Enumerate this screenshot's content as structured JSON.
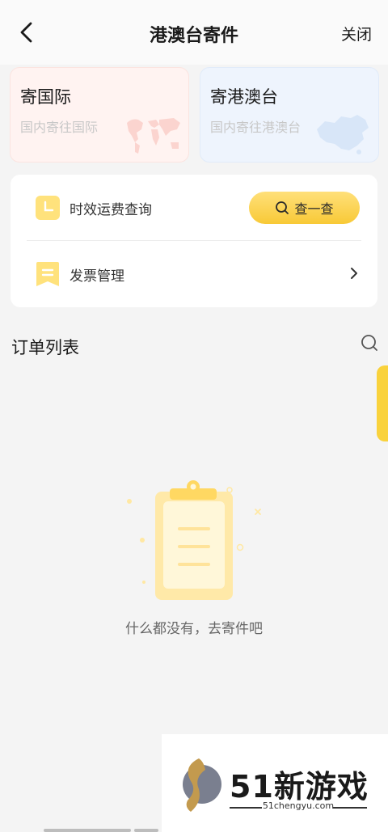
{
  "header": {
    "title": "港澳台寄件",
    "close_label": "关闭"
  },
  "entries": [
    {
      "title": "寄国际",
      "subtitle": "国内寄往国际"
    },
    {
      "title": "寄港澳台",
      "subtitle": "国内寄往港澳台"
    }
  ],
  "tools": {
    "query_label": "时效运费查询",
    "check_label": "查一查",
    "invoice_label": "发票管理"
  },
  "orders": {
    "title": "订单列表",
    "empty_text": "什么都没有，去寄件吧"
  },
  "watermark": {
    "brand": "51新游戏",
    "domain": "51chengyu.com"
  },
  "colors": {
    "accent": "#f8c936",
    "intl_card_bg": "#fff3f1",
    "hmt_card_bg": "#eef4fd"
  },
  "icons": [
    "back-arrow-icon",
    "world-map-icon",
    "china-map-icon",
    "clock-icon",
    "search-icon",
    "receipt-icon",
    "chevron-right-icon",
    "clipboard-icon"
  ]
}
